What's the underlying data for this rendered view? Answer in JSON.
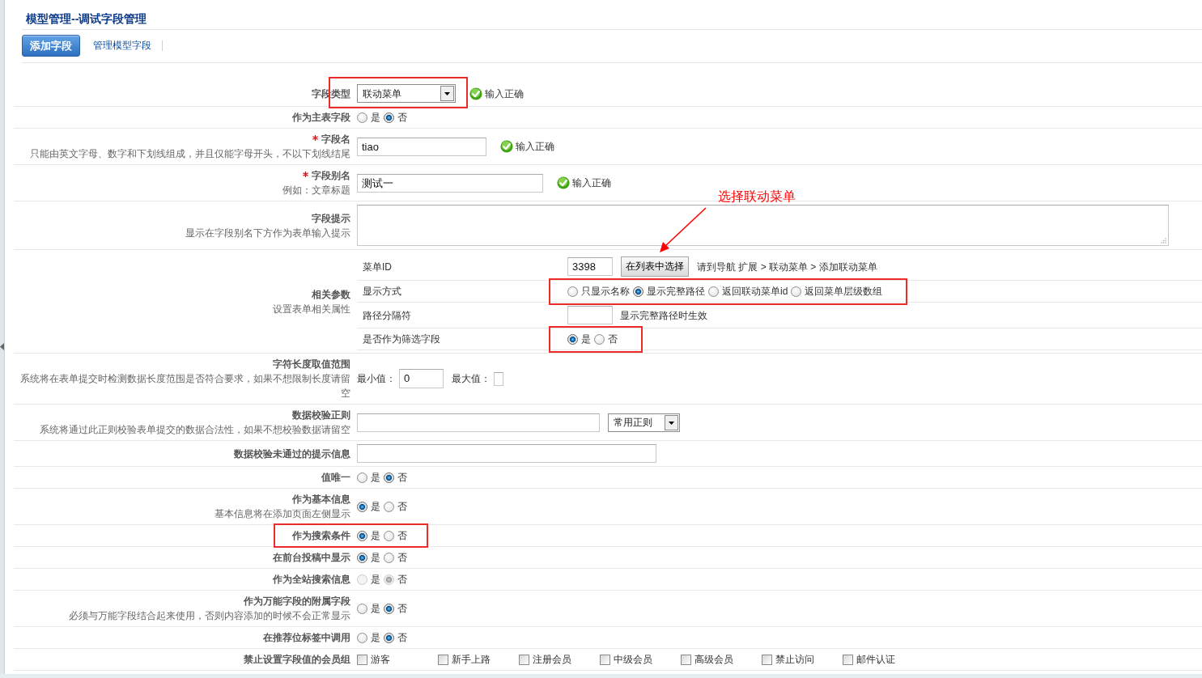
{
  "page": {
    "title": "模型管理--调试字段管理"
  },
  "tabs": [
    {
      "label": "添加字段",
      "selected": true
    },
    {
      "label": "管理模型字段",
      "selected": false
    }
  ],
  "form": {
    "rows": [
      {
        "kind": "select",
        "label": "字段类型",
        "required": false,
        "value": "联动菜单",
        "status": "输入正确",
        "highlighted": true
      },
      {
        "kind": "radio",
        "label": "作为主表字段",
        "required": false,
        "disabled": false,
        "options": [
          {
            "label": "是",
            "selected": false
          },
          {
            "label": "否",
            "selected": true
          }
        ],
        "highlighted": false
      },
      {
        "kind": "text",
        "label": "字段名",
        "required": true,
        "hint": "只能由英文字母、数字和下划线组成，并且仅能字母开头，不以下划线结尾",
        "value": "tiao",
        "status": "输入正确",
        "highlighted": false
      },
      {
        "kind": "text",
        "label": "字段别名",
        "required": true,
        "hint": "例如：文章标题",
        "value": "测试一",
        "status": "输入正确",
        "highlighted": false
      },
      {
        "kind": "textarea",
        "label": "字段提示",
        "required": false,
        "hint": "显示在字段别名下方作为表单输入提示",
        "highlighted": false
      },
      {
        "kind": "params",
        "label": "相关参数",
        "required": false,
        "hint": "设置表单相关属性",
        "highlighted": false,
        "params": [
          {
            "kind": "menu_id",
            "label": "菜单ID",
            "value": "3398",
            "button": "在列表中选择",
            "note": "请到导航 扩展 > 联动菜单 > 添加联动菜单",
            "highlighted": false
          },
          {
            "kind": "radio",
            "label": "显示方式",
            "options": [
              {
                "label": "只显示名称",
                "selected": false
              },
              {
                "label": "显示完整路径",
                "selected": true
              },
              {
                "label": "返回联动菜单id",
                "selected": false
              },
              {
                "label": "返回菜单层级数组",
                "selected": false
              }
            ],
            "highlighted": true
          },
          {
            "kind": "text",
            "label": "路径分隔符",
            "note": "显示完整路径时生效",
            "highlighted": false
          },
          {
            "kind": "radio",
            "label": "是否作为筛选字段",
            "options": [
              {
                "label": "是",
                "selected": true
              },
              {
                "label": "否",
                "selected": false
              }
            ],
            "highlighted": true
          }
        ]
      },
      {
        "kind": "range",
        "label": "字符长度取值范围",
        "required": false,
        "hint": "系统将在表单提交时检测数据长度范围是否符合要求，如果不想限制长度请留空",
        "min_label": "最小值：",
        "min_value": "0",
        "max_label": "最大值：",
        "highlighted": false
      },
      {
        "kind": "regex",
        "label": "数据校验正则",
        "required": false,
        "hint": "系统将通过此正则校验表单提交的数据合法性，如果不想校验数据请留空",
        "select": "常用正则",
        "highlighted": false
      },
      {
        "kind": "text",
        "label": "数据校验未通过的提示信息",
        "required": false,
        "highlighted": false
      },
      {
        "kind": "radio",
        "label": "值唯一",
        "required": false,
        "disabled": false,
        "options": [
          {
            "label": "是",
            "selected": false
          },
          {
            "label": "否",
            "selected": true
          }
        ],
        "highlighted": false
      },
      {
        "kind": "radio",
        "label": "作为基本信息",
        "required": false,
        "hint": "基本信息将在添加页面左侧显示",
        "disabled": false,
        "options": [
          {
            "label": "是",
            "selected": true
          },
          {
            "label": "否",
            "selected": false
          }
        ],
        "highlighted": false
      },
      {
        "kind": "radio",
        "label": "作为搜索条件",
        "required": false,
        "disabled": false,
        "options": [
          {
            "label": "是",
            "selected": true
          },
          {
            "label": "否",
            "selected": false
          }
        ],
        "highlighted": true
      },
      {
        "kind": "radio",
        "label": "在前台投稿中显示",
        "required": false,
        "disabled": false,
        "options": [
          {
            "label": "是",
            "selected": true
          },
          {
            "label": "否",
            "selected": false
          }
        ],
        "highlighted": false
      },
      {
        "kind": "radio",
        "label": "作为全站搜索信息",
        "required": false,
        "disabled": true,
        "options": [
          {
            "label": "是",
            "selected": false
          },
          {
            "label": "否",
            "selected": true
          }
        ],
        "highlighted": false
      },
      {
        "kind": "radio",
        "label": "作为万能字段的附属字段",
        "required": false,
        "hint": "必须与万能字段结合起来使用，否则内容添加的时候不会正常显示",
        "disabled": false,
        "options": [
          {
            "label": "是",
            "selected": false
          },
          {
            "label": "否",
            "selected": true
          }
        ],
        "highlighted": false
      },
      {
        "kind": "radio",
        "label": "在推荐位标签中调用",
        "required": false,
        "disabled": false,
        "options": [
          {
            "label": "是",
            "selected": false
          },
          {
            "label": "否",
            "selected": true
          }
        ],
        "highlighted": false
      },
      {
        "kind": "checkboxes",
        "label": "禁止设置字段值的会员组",
        "required": false,
        "options": [
          {
            "label": "游客",
            "checked": false
          },
          {
            "label": "新手上路",
            "checked": false
          },
          {
            "label": "注册会员",
            "checked": false
          },
          {
            "label": "中级会员",
            "checked": false
          },
          {
            "label": "高级会员",
            "checked": false
          },
          {
            "label": "禁止访问",
            "checked": false
          },
          {
            "label": "邮件认证",
            "checked": false
          }
        ],
        "highlighted": false
      }
    ]
  },
  "annotation": {
    "text": "选择联动菜单"
  }
}
